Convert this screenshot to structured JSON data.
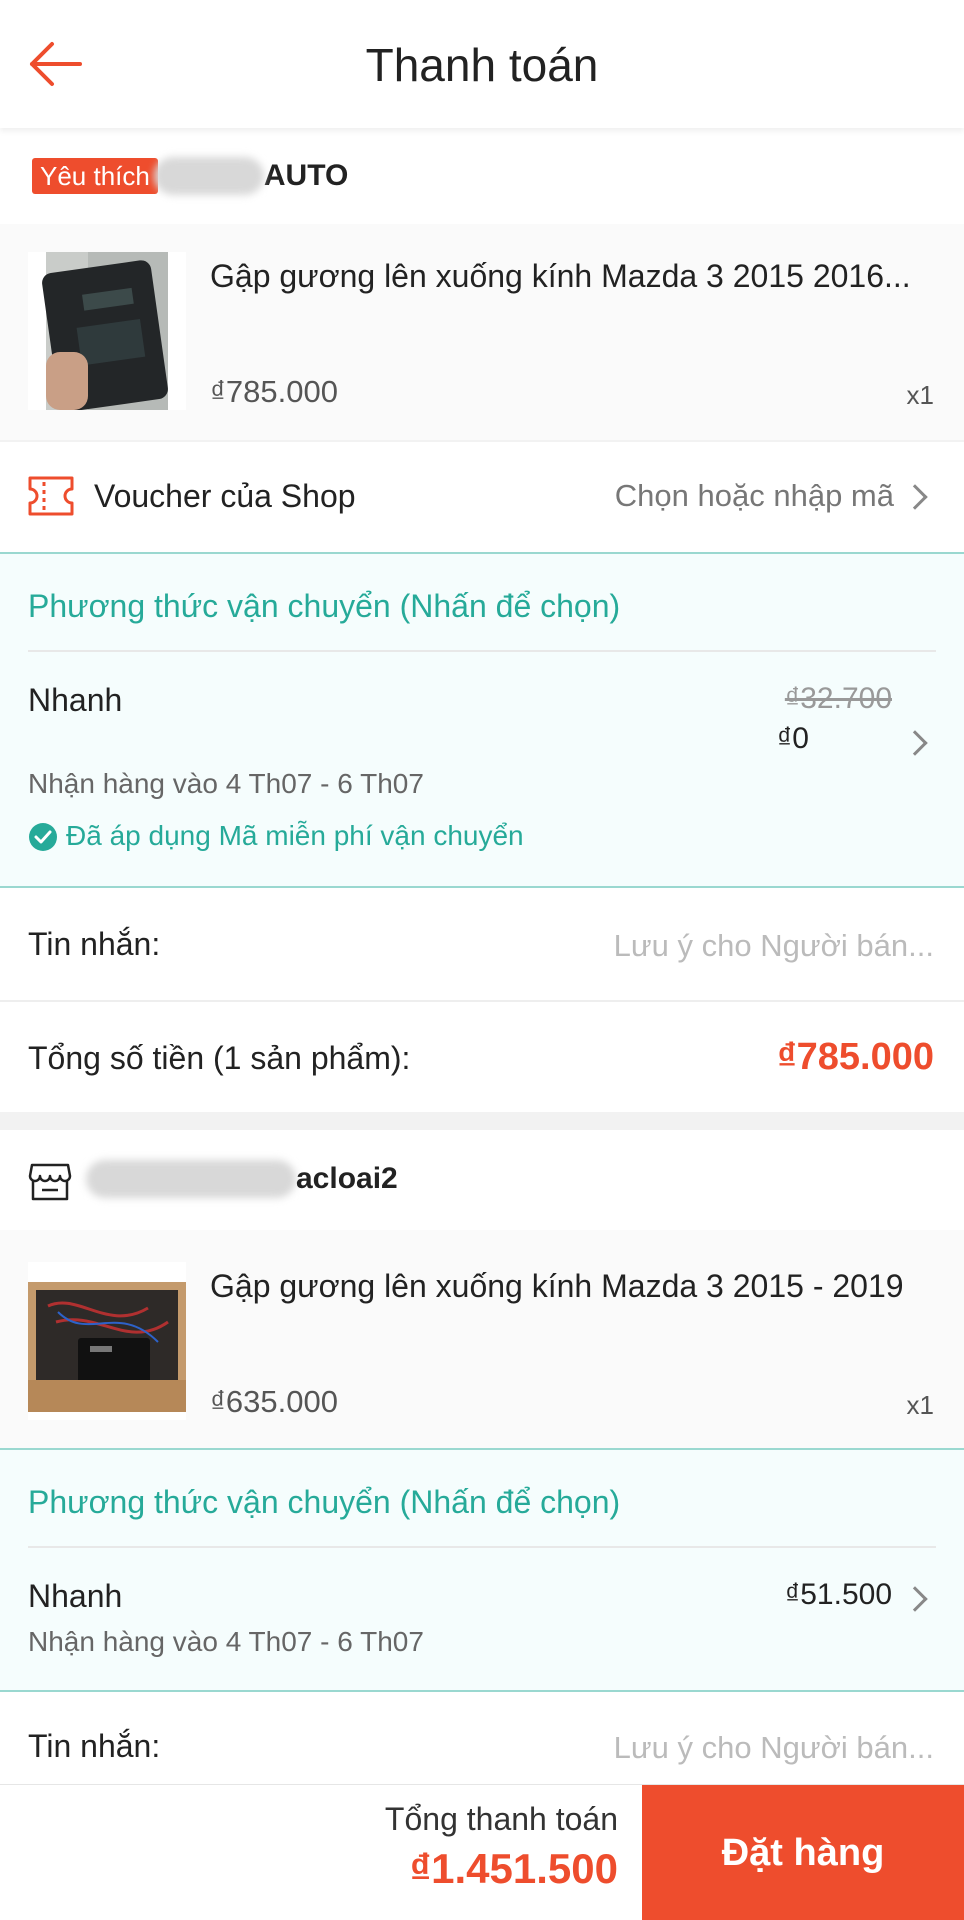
{
  "header": {
    "title": "Thanh toán",
    "back_icon": "arrow-left-icon",
    "accent": "#ee4d2d"
  },
  "shops": [
    {
      "badge": "Yêu thích",
      "name_visible": "AUTO",
      "product": {
        "name": "Gập gương lên xuống kính Mazda 3 2015 2016...",
        "price": "₫785.000",
        "qty": "x1"
      },
      "voucher": {
        "label": "Voucher của Shop",
        "action": "Chọn hoặc nhập mã"
      },
      "shipping": {
        "title": "Phương thức vận chuyển (Nhấn để chọn)",
        "method": "Nhanh",
        "old_price": "₫32.700",
        "price": "₫0",
        "eta": "Nhận hàng vào 4 Th07 - 6 Th07",
        "applied": "Đã áp dụng Mã miễn phí vận chuyển"
      },
      "message": {
        "label": "Tin nhắn:",
        "placeholder": "Lưu ý cho Người bán..."
      },
      "total": {
        "label": "Tổng số tiền (1 sản phẩm):",
        "value": "₫785.000"
      }
    },
    {
      "name_visible": "acloai2",
      "product": {
        "name": "Gập gương lên xuống kính Mazda 3 2015 - 2019",
        "price": "₫635.000",
        "qty": "x1"
      },
      "shipping": {
        "title": "Phương thức vận chuyển (Nhấn để chọn)",
        "method": "Nhanh",
        "price": "₫51.500",
        "eta": "Nhận hàng vào 4 Th07 - 6 Th07"
      },
      "message": {
        "label": "Tin nhắn:",
        "placeholder": "Lưu ý cho Người bán..."
      }
    }
  ],
  "footer": {
    "total_label": "Tổng thanh toán",
    "total_value": "₫1.451.500",
    "order_button": "Đặt hàng"
  },
  "colors": {
    "primary": "#ee4d2d",
    "teal": "#26aa99"
  }
}
